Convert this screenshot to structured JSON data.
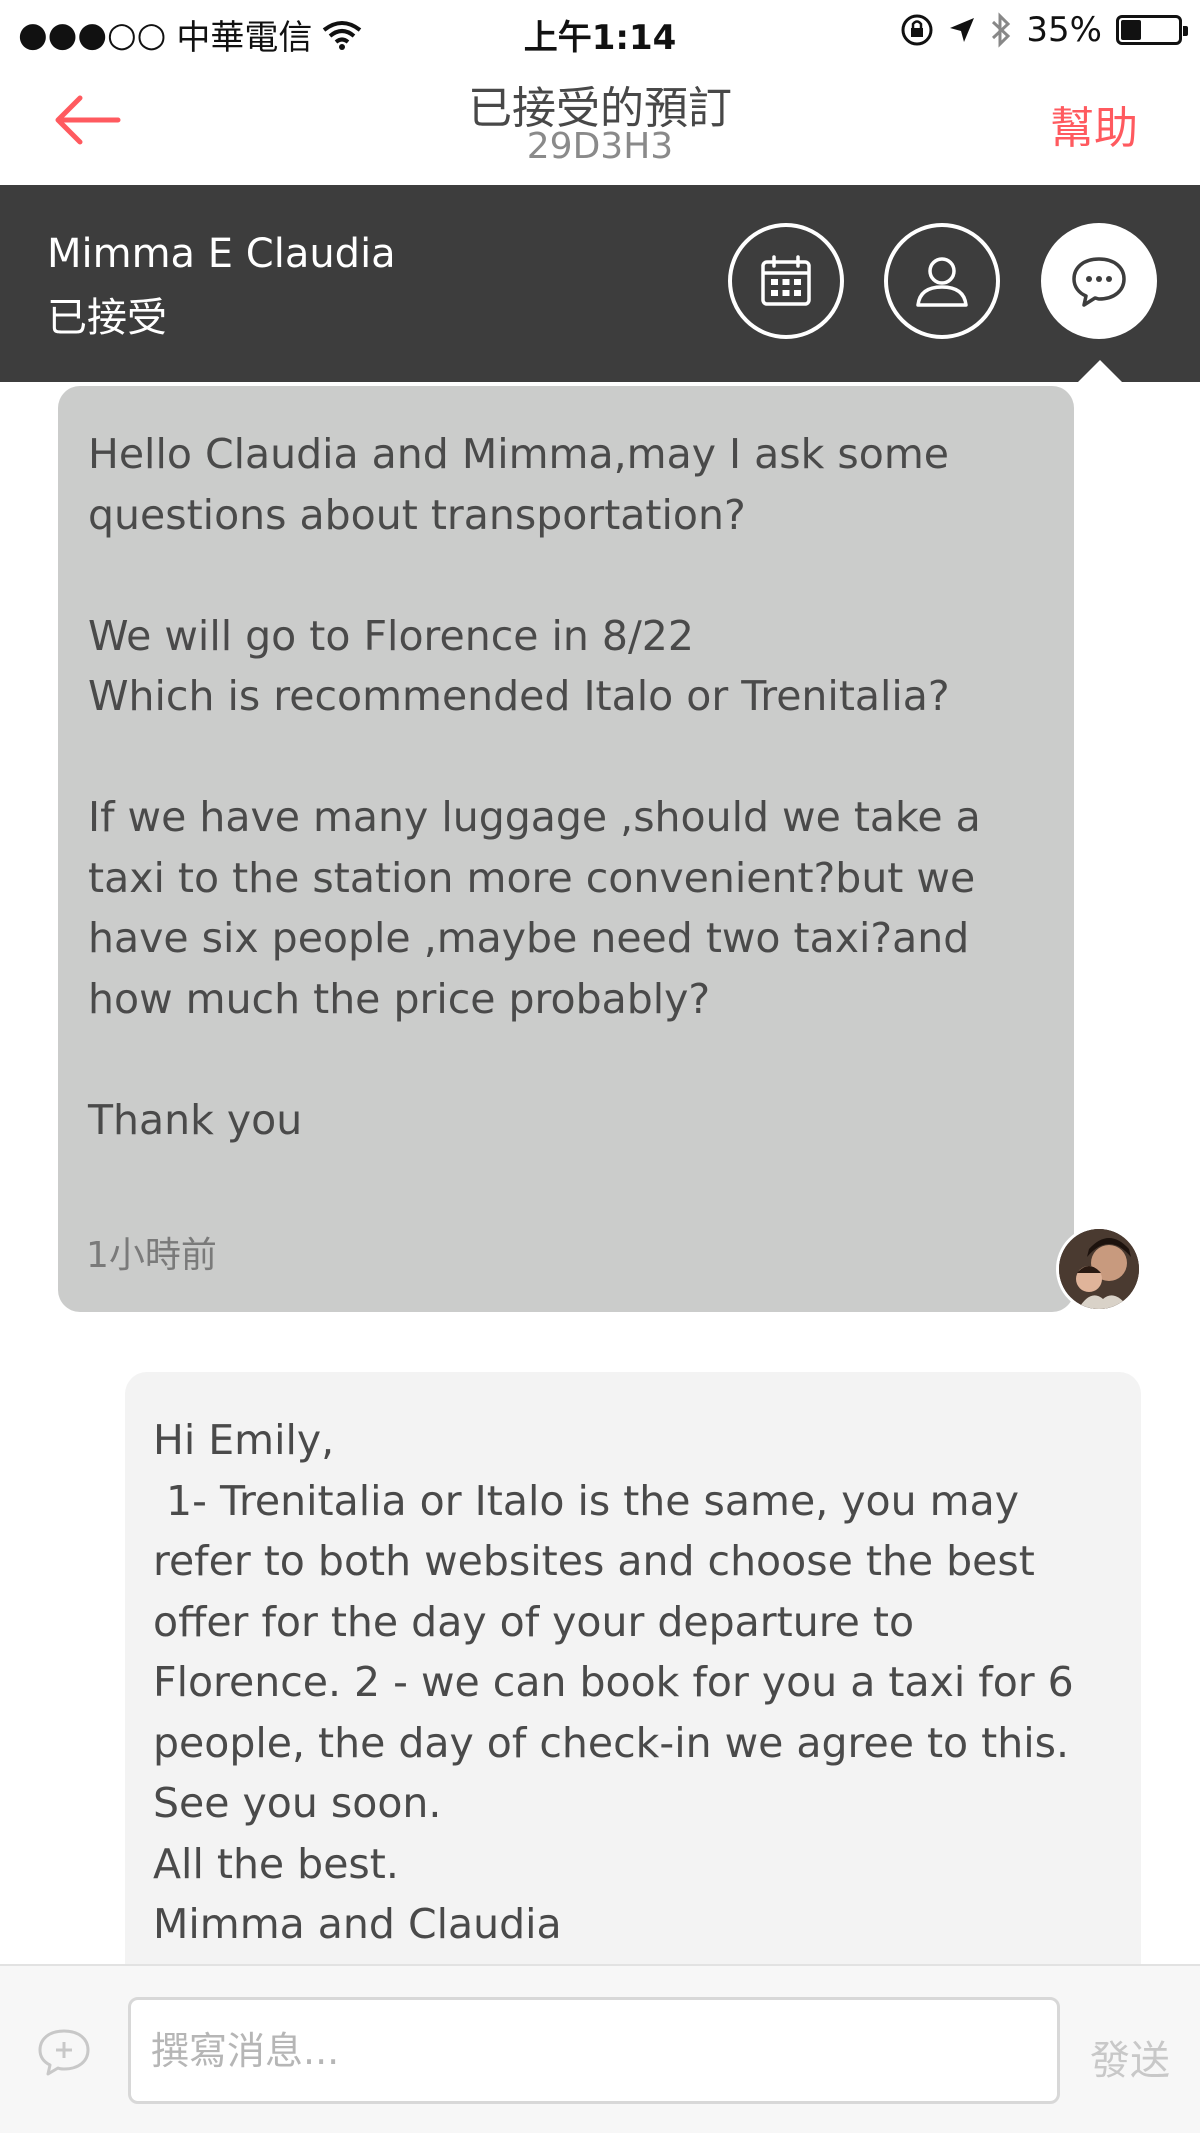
{
  "status_bar": {
    "signal": "●●●○○",
    "carrier": "中華電信",
    "time": "上午1:14",
    "battery_text": "35%",
    "battery_level": 0.35
  },
  "nav": {
    "title": "已接受的預訂",
    "confirmation_code": "29D3H3",
    "help_label": "幫助"
  },
  "header": {
    "guest_name": "Mimma E Claudia",
    "reservation_status": "已接受",
    "icons": [
      "calendar-icon",
      "user-icon",
      "message-icon"
    ]
  },
  "messages": [
    {
      "direction": "incoming",
      "text": "Hello Claudia and Mimma,may I ask some\nquestions about transportation?\n\nWe will go to Florence in 8/22\nWhich is recommended Italo or Trenitalia?\n\nIf we have many luggage ,should we take a\ntaxi to the station more convenient?but we\nhave six people ,maybe need two taxi?and\nhow much the price probably?\n\nThank you",
      "time": "1小時前"
    },
    {
      "direction": "outgoing",
      "text": "Hi Emily,\n 1- Trenitalia or Italo is the same, you may\nrefer to both websites and choose the best\noffer for the day of your departure to\nFlorence. 2 - we can book for you a taxi for 6\npeople, the day of check-in we agree to this.\nSee you soon.\nAll the best.\nMimma and Claudia"
    }
  ],
  "compose": {
    "placeholder": "撰寫消息...",
    "value": "",
    "send_label": "發送"
  },
  "colors": {
    "accent": "#ff5a5f",
    "header_bg": "#3d3d3d",
    "incoming_bubble": "#cbcccb",
    "outgoing_bubble": "#f3f3f3"
  }
}
